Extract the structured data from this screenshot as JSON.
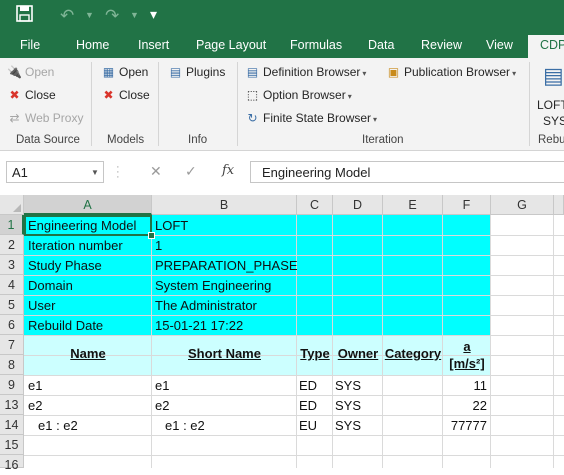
{
  "quick_access": {
    "save_icon": "save-icon",
    "undo_icon": "undo-icon",
    "redo_icon": "redo-icon"
  },
  "tabs": [
    "File",
    "Home",
    "Insert",
    "Page Layout",
    "Formulas",
    "Data",
    "Review",
    "View",
    "CDP"
  ],
  "ribbon": {
    "data_source": {
      "label": "Data Source",
      "open": "Open",
      "close": "Close",
      "web_proxy": "Web Proxy"
    },
    "models": {
      "label": "Models",
      "open": "Open",
      "close": "Close"
    },
    "info": {
      "label": "Info",
      "plugins": "Plugins"
    },
    "iteration": {
      "label": "Iteration",
      "definition_browser": "Definition Browser",
      "option_browser": "Option Browser",
      "finite_state_browser": "Finite State Browser",
      "publication_browser": "Publication Browser"
    },
    "rebuild": {
      "label": "Rebu",
      "line1": "LOFT",
      "line2": "SYS"
    }
  },
  "formula_bar": {
    "name_box": "A1",
    "fx": "fx",
    "cancel": "✕",
    "enter": "✓",
    "value": "Engineering Model"
  },
  "grid": {
    "columns": [
      "A",
      "B",
      "C",
      "D",
      "E",
      "F",
      "G"
    ],
    "row_numbers": [
      "1",
      "2",
      "3",
      "4",
      "5",
      "6",
      "7",
      "8",
      "9",
      "13",
      "14",
      "15",
      "16"
    ],
    "info_rows": [
      {
        "label": "Engineering Model",
        "value": "LOFT"
      },
      {
        "label": "Iteration number",
        "value": "1"
      },
      {
        "label": "Study Phase",
        "value": "PREPARATION_PHASE"
      },
      {
        "label": "Domain",
        "value": "System Engineering"
      },
      {
        "label": "User",
        "value": "The Administrator"
      },
      {
        "label": "Rebuild Date",
        "value": "15-01-21 17:22"
      }
    ],
    "headers": {
      "name": "Name",
      "short_name": "Short Name",
      "type": "Type",
      "owner": "Owner",
      "category": "Category",
      "param": "a",
      "param_unit": "[m/s²]"
    },
    "data_rows": [
      {
        "name": "e1",
        "short_name": "e1",
        "type": "ED",
        "owner": "SYS",
        "category": "",
        "value": "11"
      },
      {
        "name": "e2",
        "short_name": "e2",
        "type": "ED",
        "owner": "SYS",
        "category": "",
        "value": "22"
      },
      {
        "name": "e1 : e2",
        "short_name": "e1 : e2",
        "type": "EU",
        "owner": "SYS",
        "category": "",
        "value": "77777"
      }
    ]
  },
  "colors": {
    "excel_green": "#217346",
    "info_fill": "#00ffff",
    "header_fill": "#ccffff"
  }
}
